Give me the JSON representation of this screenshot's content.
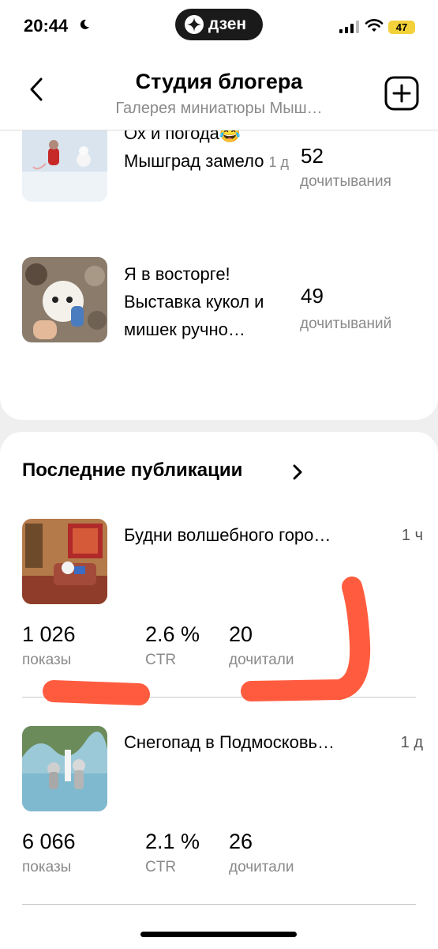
{
  "status_bar": {
    "time": "20:44",
    "brand": "дзен",
    "battery": "47"
  },
  "header": {
    "title": "Студия блогера",
    "subtitle": "Галерея миниатюры Мыш…"
  },
  "top_articles": [
    {
      "title": "Ох и погода😂 Мышград замело",
      "age": "1 д",
      "count": "52",
      "label": "дочитывания"
    },
    {
      "title": "Я в восторге! Выставка кукол и мишек ручно…",
      "count": "49",
      "label": "дочитываний"
    }
  ],
  "recent": {
    "section_title": "Последние публикации",
    "items": [
      {
        "title": "Будни волшебного горо…",
        "time": "1 ч",
        "views": "1 026",
        "views_label": "показы",
        "ctr": "2.6 %",
        "ctr_label": "CTR",
        "reads": "20",
        "reads_label": "дочитали"
      },
      {
        "title": "Снегопад в Подмосковь…",
        "time": "1 д",
        "views": "6 066",
        "views_label": "показы",
        "ctr": "2.1 %",
        "ctr_label": "CTR",
        "reads": "26",
        "reads_label": "дочитали"
      }
    ]
  },
  "colors": {
    "annotation": "#ff4a2a",
    "battery": "#f3d13a"
  }
}
